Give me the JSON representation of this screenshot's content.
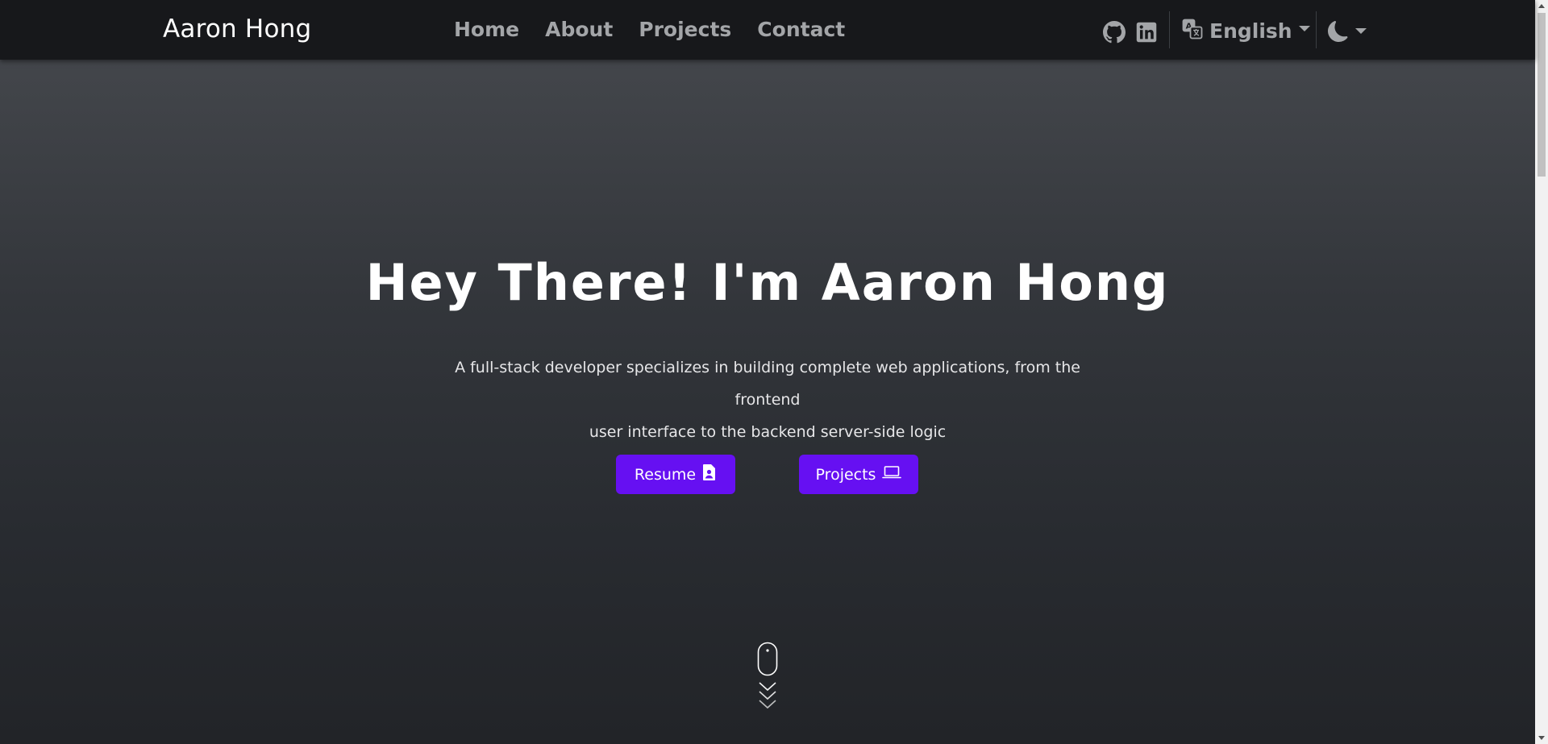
{
  "navbar": {
    "brand": "Aaron Hong",
    "links": [
      {
        "label": "Home"
      },
      {
        "label": "About"
      },
      {
        "label": "Projects"
      },
      {
        "label": "Contact"
      }
    ],
    "icons": [
      "github-icon",
      "linkedin-icon",
      "translate-icon",
      "moon-icon"
    ],
    "language": "English"
  },
  "hero": {
    "title": "Hey There! I'm Aaron Hong",
    "subtitle_line1": "A full-stack developer specializes in building complete web applications, from the frontend",
    "subtitle_line2": "user interface to the backend server-side logic",
    "resume_label": "Resume",
    "projects_label": "Projects"
  },
  "colors": {
    "accent": "#6610f2",
    "navbar_bg": "#17181b",
    "nav_text": "#a3a5a8",
    "hero_top": "#43464b",
    "hero_bottom": "#222428"
  }
}
